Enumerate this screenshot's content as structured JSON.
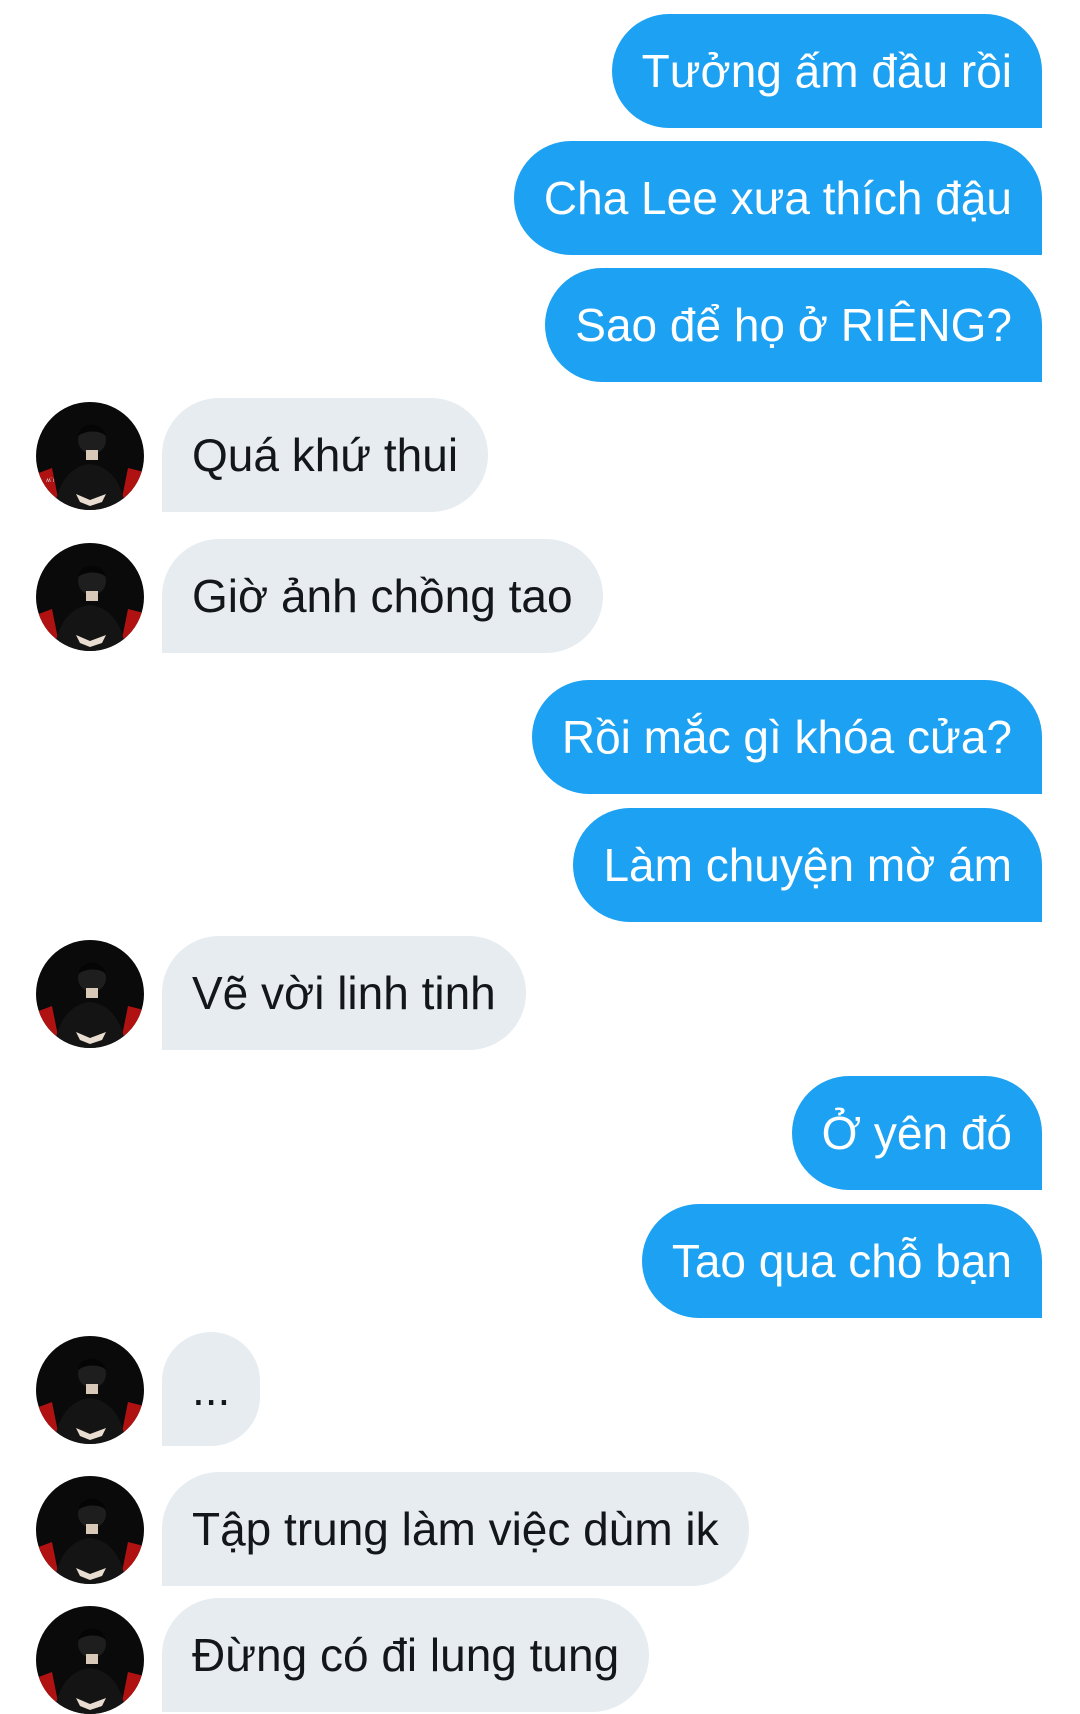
{
  "contact": {
    "avatar_icon": "contact-avatar-photo",
    "colors": {
      "background": "#0a0a0a",
      "seat_red": "#b01212",
      "clothing": "#141414"
    }
  },
  "colors": {
    "outgoing_bubble": "#1da1f2",
    "outgoing_text": "#ffffff",
    "incoming_bubble": "#e6ecf0",
    "incoming_text": "#14171a"
  },
  "messages": [
    {
      "direction": "outgoing",
      "text": "Tưởng ấm đầu rồi"
    },
    {
      "direction": "outgoing",
      "text": "Cha Lee xưa thích đậu"
    },
    {
      "direction": "outgoing",
      "text": "Sao để họ ở RIÊNG?"
    },
    {
      "direction": "incoming",
      "text": "Quá khứ thui"
    },
    {
      "direction": "incoming",
      "text": "Giờ ảnh chồng tao"
    },
    {
      "direction": "outgoing",
      "text": "Rồi mắc gì khóa cửa?"
    },
    {
      "direction": "outgoing",
      "text": "Làm chuyện mờ ám"
    },
    {
      "direction": "incoming",
      "text": "Vẽ vời linh tinh"
    },
    {
      "direction": "outgoing",
      "text": "Ở yên đó"
    },
    {
      "direction": "outgoing",
      "text": "Tao qua chỗ bạn"
    },
    {
      "direction": "incoming",
      "text": "..."
    },
    {
      "direction": "incoming",
      "text": "Tập trung làm việc dùm ik"
    },
    {
      "direction": "incoming",
      "text": "Đừng có đi lung tung"
    }
  ]
}
